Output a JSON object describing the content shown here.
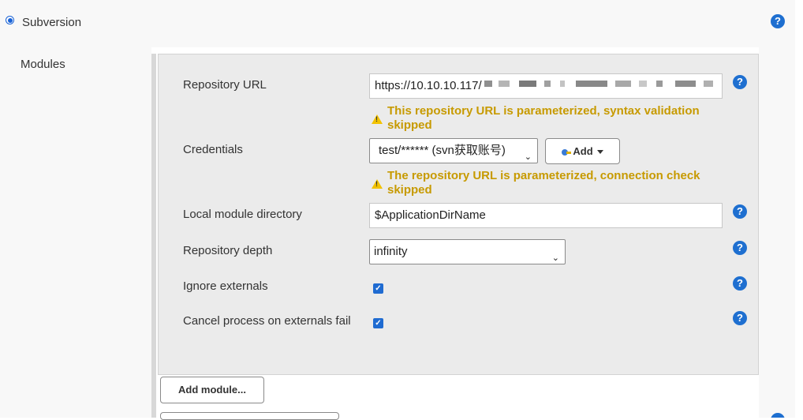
{
  "section": {
    "title": "Subversion"
  },
  "modules": {
    "label": "Modules"
  },
  "repository_url": {
    "label": "Repository URL",
    "value": "https://10.10.10.117/",
    "warning": "This repository URL is parameterized, syntax validation skipped"
  },
  "credentials": {
    "label": "Credentials",
    "selected": "test/****** (svn获取账号)",
    "add_label": "Add",
    "warning": "The repository URL is parameterized, connection check skipped"
  },
  "local_module_directory": {
    "label": "Local module directory",
    "value": "$ApplicationDirName"
  },
  "repository_depth": {
    "label": "Repository depth",
    "selected": "infinity"
  },
  "ignore_externals": {
    "label": "Ignore externals",
    "checked": true
  },
  "cancel_process": {
    "label": "Cancel process on externals fail",
    "checked": true
  },
  "add_module_button": {
    "label": "Add module..."
  },
  "icons": {
    "help": "question-circle-icon",
    "warning": "warning-triangle-icon",
    "key": "key-icon"
  },
  "colors": {
    "accent": "#1e6fd0",
    "warning_text": "#c79a00",
    "panel_bg": "#ebebeb"
  }
}
